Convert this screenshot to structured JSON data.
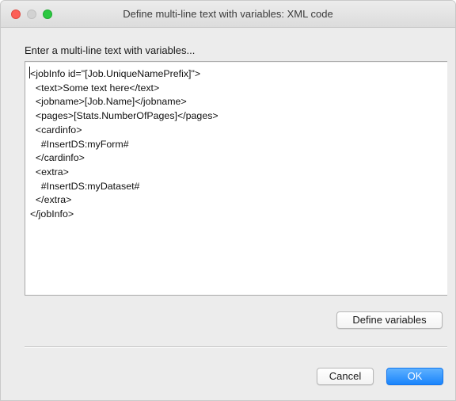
{
  "window": {
    "title": "Define multi-line text with variables: XML code"
  },
  "prompt": "Enter a multi-line text with variables...",
  "editor": {
    "lines": [
      "<jobInfo id=\"[Job.UniqueNamePrefix]\">",
      "  <text>Some text here</text>",
      "  <jobname>[Job.Name]</jobname>",
      "  <pages>[Stats.NumberOfPages]</pages>",
      "  <cardinfo>",
      "    #InsertDS:myForm#",
      "  </cardinfo>",
      "  <extra>",
      "    #InsertDS:myDataset#",
      "  </extra>",
      "</jobInfo>"
    ]
  },
  "buttons": {
    "define_variables": "Define variables",
    "cancel": "Cancel",
    "ok": "OK"
  },
  "colors": {
    "window_bg": "#ececec",
    "accent": "#1a84fb",
    "traffic_close": "#fc5f57",
    "traffic_min": "#d2d2d2",
    "traffic_max": "#2bc840"
  }
}
